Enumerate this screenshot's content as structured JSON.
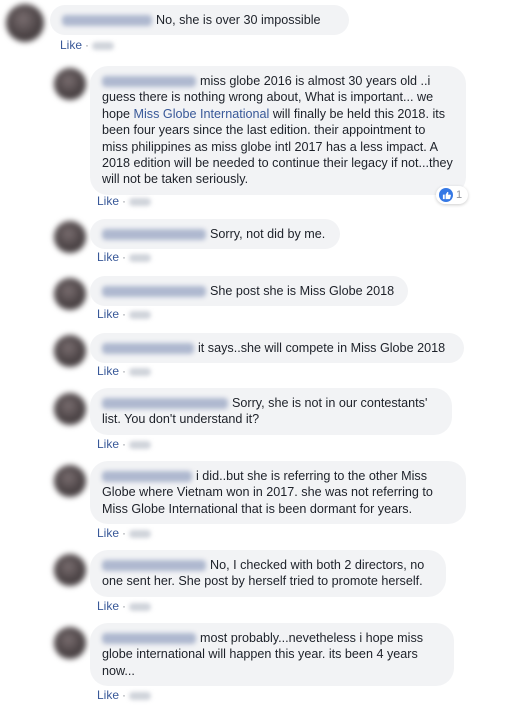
{
  "like_label": "Like",
  "separator": "·",
  "comments": [
    {
      "text": "No, she is over 30 impossible"
    },
    {
      "text_before": "miss globe 2016 is almost 30 years old ..i guess there is nothing wrong about, What is important... we hope ",
      "link": "Miss Globe International",
      "text_after": " will finally be held this 2018. its been four years since the last edition. their appointment to miss philippines as miss globe intl 2017 has a less impact. A 2018 edition will be needed to continue their legacy if not...they will not be taken seriously.",
      "reaction_count": "1",
      "reaction_icon": "like-reaction-icon"
    },
    {
      "text": "Sorry, not did by me."
    },
    {
      "text": "She post she is Miss Globe 2018"
    },
    {
      "text": "it says..she will compete in Miss Globe 2018"
    },
    {
      "text": "Sorry, she is not in our contestants' list. You don't understand it?"
    },
    {
      "text": "i did..but she is referring to the other Miss Globe where Vietnam won in 2017. she was not referring to Miss Globe International that is been dormant for years."
    },
    {
      "text": "No, I checked with both 2 directors, no one sent her. She post by herself tried to promote herself."
    },
    {
      "text": "most probably...nevetheless i hope miss globe international will happen this year. its been 4 years now..."
    }
  ]
}
